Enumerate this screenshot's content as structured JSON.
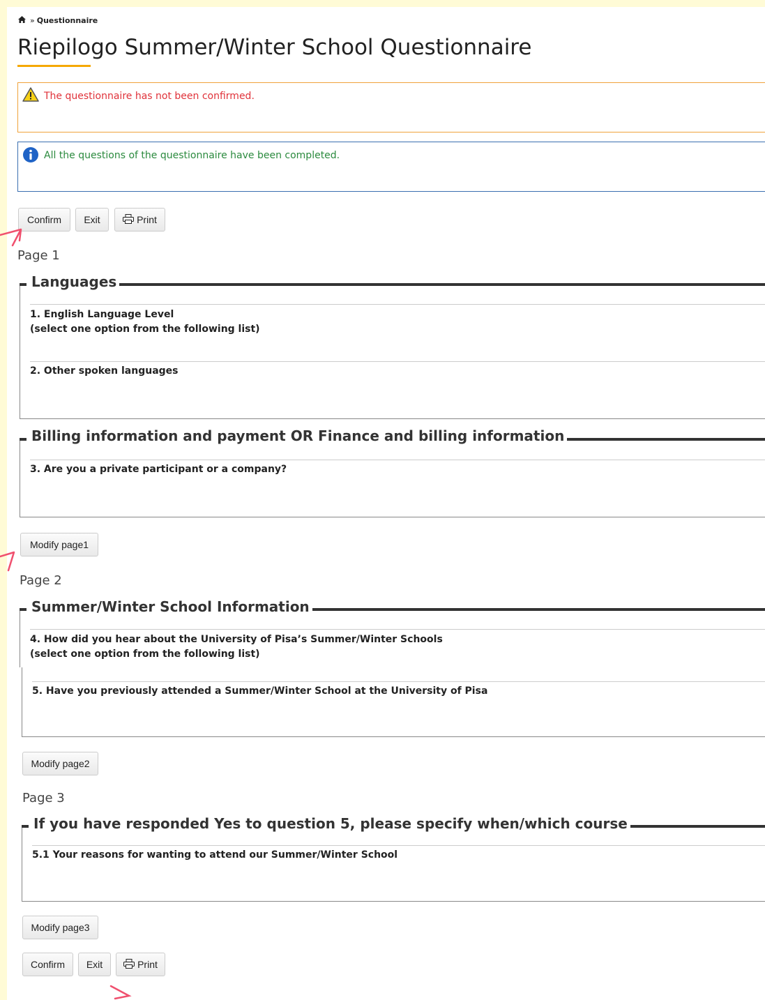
{
  "breadcrumb": {
    "home_icon": "home-icon",
    "separator": "»",
    "current": "Questionnaire"
  },
  "title": "Riepilogo Summer/Winter School Questionnaire",
  "alerts": {
    "warning": {
      "icon": "warning-icon",
      "text": "The questionnaire has not been confirmed."
    },
    "info": {
      "icon": "info-icon",
      "text": "All the questions of the questionnaire have been completed."
    }
  },
  "toolbar_top": {
    "confirm": "Confirm",
    "exit": "Exit",
    "print": "Print"
  },
  "toolbar_bottom": {
    "confirm": "Confirm",
    "exit": "Exit",
    "print": "Print"
  },
  "pages": [
    {
      "label": "Page 1",
      "sections": [
        {
          "legend": "Languages",
          "questions": [
            {
              "text": "1. English Language Level",
              "note": "(select one option from the following list)"
            },
            {
              "text": "2. Other spoken languages"
            }
          ]
        },
        {
          "legend": "Billing information and payment OR Finance and billing information",
          "questions": [
            {
              "text": "3. Are you a private participant or a company?"
            }
          ]
        }
      ],
      "modify_label": "Modify page1"
    },
    {
      "label": "Page 2",
      "sections": [
        {
          "legend": "Summer/Winter School Information",
          "questions": [
            {
              "text": "4. How did you hear about the University of Pisa’s Summer/Winter Schools",
              "note": "(select one option from the following list)"
            },
            {
              "text": "5. Have you previously attended a Summer/Winter School at the University of Pisa"
            }
          ]
        }
      ],
      "modify_label": "Modify page2"
    },
    {
      "label": "Page 3",
      "sections": [
        {
          "legend": "If you have responded Yes to question 5, please specify when/which course",
          "questions": [
            {
              "text": "5.1 Your reasons for wanting to attend our Summer/Winter School"
            }
          ]
        }
      ],
      "modify_label": "Modify page3"
    }
  ],
  "colors": {
    "accent_underline": "#f5a800",
    "warning_text": "#e0323a",
    "info_text": "#2b8a3e",
    "annotation_arrow": "#f0506e",
    "page_background": "#fffbd6"
  }
}
